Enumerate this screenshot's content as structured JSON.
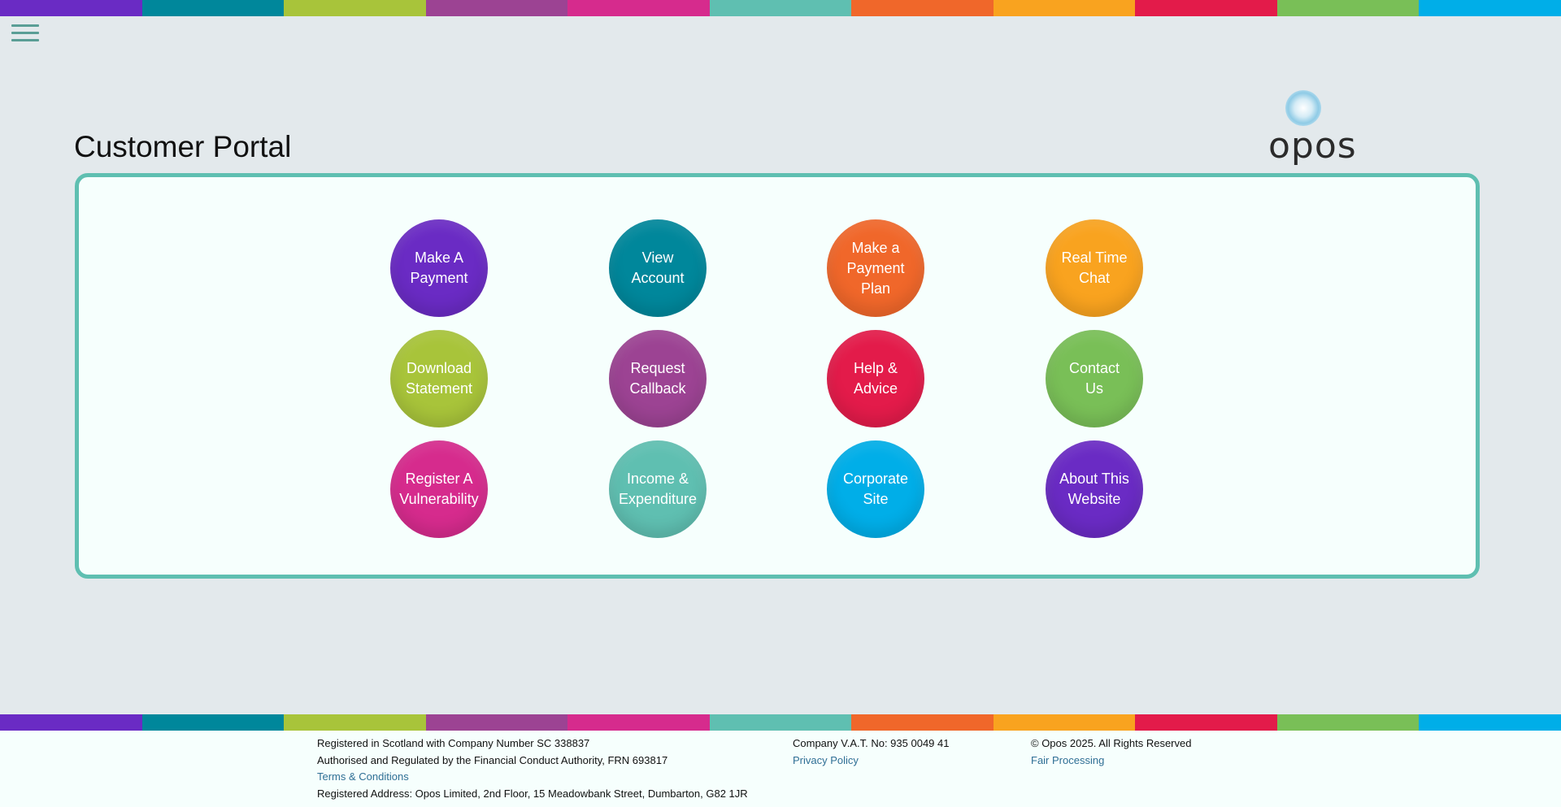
{
  "brand": {
    "stripe_colors": [
      "#6a2bc4",
      "#00879b",
      "#a8c43a",
      "#9c4393",
      "#d62b8d",
      "#5fbfb1",
      "#f0672a",
      "#f9a31f",
      "#e31b4a",
      "#79bf57",
      "#00aee8"
    ],
    "logo_text": "opos",
    "accent": "#5fbfb1"
  },
  "header": {
    "menu_icon": "hamburger-menu-icon",
    "title": "Customer Portal"
  },
  "actions": [
    {
      "label_line1": "Make A",
      "label_line2": "Payment",
      "color": "#6a2bc4"
    },
    {
      "label_line1": "View",
      "label_line2": "Account",
      "color": "#00879b"
    },
    {
      "label_line1": "Make a",
      "label_line2": "Payment Plan",
      "color": "#f0672a"
    },
    {
      "label_line1": "Real Time",
      "label_line2": "Chat",
      "color": "#f9a31f"
    },
    {
      "label_line1": "Download",
      "label_line2": "Statement",
      "color": "#a8c43a"
    },
    {
      "label_line1": "Request",
      "label_line2": "Callback",
      "color": "#9c4393"
    },
    {
      "label_line1": "Help &",
      "label_line2": "Advice",
      "color": "#e31b4a"
    },
    {
      "label_line1": "Contact",
      "label_line2": "Us",
      "color": "#79bf57"
    },
    {
      "label_line1": "Register A",
      "label_line2": "Vulnerability",
      "color": "#d62b8d"
    },
    {
      "label_line1": "Income &",
      "label_line2": "Expenditure",
      "color": "#5fbfb1"
    },
    {
      "label_line1": "Corporate",
      "label_line2": "Site",
      "color": "#00aee8"
    },
    {
      "label_line1": "About This",
      "label_line2": "Website",
      "color": "#6a2bc4"
    }
  ],
  "footer": {
    "registration": "Registered in Scotland with Company Number SC 338837",
    "regulation": "Authorised and Regulated by the Financial Conduct Authority, FRN 693817",
    "terms_link": "Terms & Conditions",
    "address": "Registered Address: Opos Limited, 2nd Floor, 15 Meadowbank Street, Dumbarton, G82 1JR",
    "vat": "Company V.A.T. No: 935 0049 41",
    "privacy_link": "Privacy Policy",
    "copyright": "© Opos 2025.  All Rights Reserved",
    "fair_processing_link": "Fair Processing"
  }
}
